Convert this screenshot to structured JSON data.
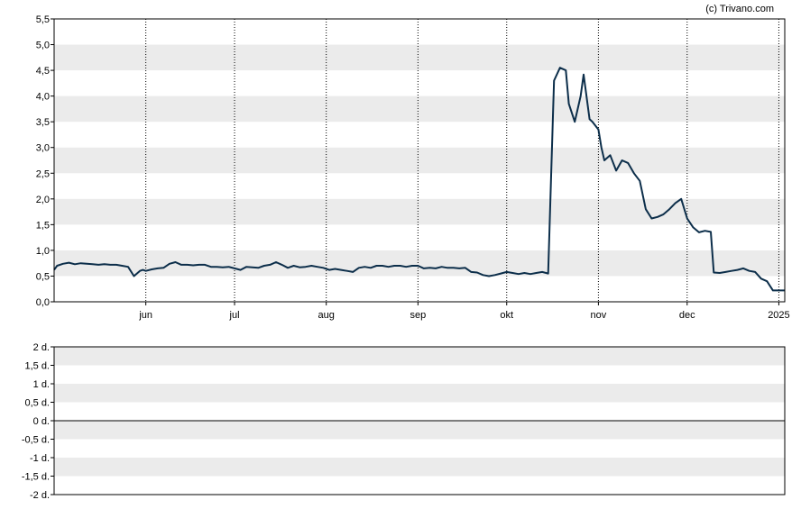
{
  "credit": "(c) Trivano.com",
  "colors": {
    "line": "#0c2e4a",
    "band": "#ebebeb",
    "axis": "#000000",
    "gridline": "#000000"
  },
  "chart_data": [
    {
      "type": "line",
      "title": "",
      "xlabel": "",
      "ylabel": "",
      "ylim": [
        0,
        5.5
      ],
      "yticks": [
        "0,0",
        "0,5",
        "1,0",
        "1,5",
        "2,0",
        "2,5",
        "3,0",
        "3,5",
        "4,0",
        "4,5",
        "5,0",
        "5,5"
      ],
      "ytick_values": [
        0,
        0.5,
        1,
        1.5,
        2,
        2.5,
        3,
        3.5,
        4,
        4.5,
        5,
        5.5
      ],
      "xlim": [
        "2024-05-01",
        "2025-01-03"
      ],
      "xticks": [
        {
          "label": "jun",
          "date": "2024-06-01"
        },
        {
          "label": "jul",
          "date": "2024-07-01"
        },
        {
          "label": "aug",
          "date": "2024-08-01"
        },
        {
          "label": "sep",
          "date": "2024-09-01"
        },
        {
          "label": "okt",
          "date": "2024-10-01"
        },
        {
          "label": "nov",
          "date": "2024-11-01"
        },
        {
          "label": "dec",
          "date": "2024-12-01"
        },
        {
          "label": "2025",
          "date": "2025-01-01"
        }
      ],
      "grid": "vertical dotted at month starts, horizontal alternating bands",
      "series": [
        {
          "x": [
            "2024-05-01",
            "2024-05-02",
            "2024-05-04",
            "2024-05-06",
            "2024-05-08",
            "2024-05-10",
            "2024-05-12",
            "2024-05-14",
            "2024-05-16",
            "2024-05-18",
            "2024-05-20",
            "2024-05-22",
            "2024-05-24",
            "2024-05-26",
            "2024-05-28",
            "2024-05-30",
            "2024-05-31",
            "2024-06-01",
            "2024-06-03",
            "2024-06-05",
            "2024-06-07",
            "2024-06-09",
            "2024-06-11",
            "2024-06-13",
            "2024-06-15",
            "2024-06-17",
            "2024-06-19",
            "2024-06-21",
            "2024-06-23",
            "2024-06-25",
            "2024-06-27",
            "2024-06-29",
            "2024-07-01",
            "2024-07-03",
            "2024-07-05",
            "2024-07-07",
            "2024-07-09",
            "2024-07-11",
            "2024-07-13",
            "2024-07-15",
            "2024-07-17",
            "2024-07-19",
            "2024-07-21",
            "2024-07-23",
            "2024-07-25",
            "2024-07-27",
            "2024-07-29",
            "2024-07-31",
            "2024-08-02",
            "2024-08-04",
            "2024-08-06",
            "2024-08-08",
            "2024-08-10",
            "2024-08-12",
            "2024-08-14",
            "2024-08-16",
            "2024-08-18",
            "2024-08-20",
            "2024-08-22",
            "2024-08-24",
            "2024-08-26",
            "2024-08-28",
            "2024-08-30",
            "2024-09-01",
            "2024-09-03",
            "2024-09-05",
            "2024-09-07",
            "2024-09-09",
            "2024-09-11",
            "2024-09-13",
            "2024-09-15",
            "2024-09-17",
            "2024-09-19",
            "2024-09-21",
            "2024-09-23",
            "2024-09-25",
            "2024-09-27",
            "2024-09-29",
            "2024-10-01",
            "2024-10-03",
            "2024-10-05",
            "2024-10-07",
            "2024-10-09",
            "2024-10-11",
            "2024-10-13",
            "2024-10-15",
            "2024-10-17",
            "2024-10-19",
            "2024-10-21",
            "2024-10-22",
            "2024-10-24",
            "2024-10-26",
            "2024-10-27",
            "2024-10-29",
            "2024-10-30",
            "2024-11-01",
            "2024-11-02",
            "2024-11-03",
            "2024-11-05",
            "2024-11-07",
            "2024-11-09",
            "2024-11-11",
            "2024-11-13",
            "2024-11-15",
            "2024-11-17",
            "2024-11-19",
            "2024-11-21",
            "2024-11-23",
            "2024-11-25",
            "2024-11-27",
            "2024-11-29",
            "2024-12-01",
            "2024-12-03",
            "2024-12-05",
            "2024-12-07",
            "2024-12-09",
            "2024-12-10",
            "2024-12-12",
            "2024-12-14",
            "2024-12-16",
            "2024-12-18",
            "2024-12-20",
            "2024-12-22",
            "2024-12-24",
            "2024-12-26",
            "2024-12-28",
            "2024-12-30",
            "2025-01-01",
            "2025-01-03"
          ],
          "y": [
            0.62,
            0.7,
            0.74,
            0.76,
            0.73,
            0.75,
            0.74,
            0.73,
            0.72,
            0.73,
            0.72,
            0.72,
            0.7,
            0.68,
            0.5,
            0.6,
            0.62,
            0.6,
            0.63,
            0.65,
            0.66,
            0.74,
            0.77,
            0.72,
            0.72,
            0.71,
            0.72,
            0.72,
            0.68,
            0.68,
            0.67,
            0.68,
            0.65,
            0.62,
            0.68,
            0.67,
            0.66,
            0.7,
            0.72,
            0.77,
            0.72,
            0.66,
            0.7,
            0.67,
            0.68,
            0.7,
            0.68,
            0.66,
            0.62,
            0.64,
            0.62,
            0.6,
            0.58,
            0.66,
            0.68,
            0.66,
            0.7,
            0.7,
            0.68,
            0.7,
            0.7,
            0.68,
            0.7,
            0.7,
            0.65,
            0.66,
            0.65,
            0.68,
            0.66,
            0.66,
            0.65,
            0.66,
            0.58,
            0.57,
            0.52,
            0.5,
            0.52,
            0.55,
            0.58,
            0.56,
            0.54,
            0.56,
            0.54,
            0.56,
            0.58,
            0.55,
            4.3,
            4.55,
            4.5,
            3.85,
            3.5,
            4.0,
            4.42,
            3.55,
            3.5,
            3.35,
            3.0,
            2.75,
            2.85,
            2.55,
            2.75,
            2.7,
            2.5,
            2.35,
            1.8,
            1.62,
            1.65,
            1.7,
            1.8,
            1.92,
            2.0,
            1.62,
            1.45,
            1.35,
            1.38,
            1.36,
            0.57,
            0.56,
            0.58,
            0.6,
            0.62,
            0.65,
            0.6,
            0.58,
            0.45,
            0.4,
            0.22,
            0.22,
            0.22
          ]
        }
      ]
    },
    {
      "type": "bar",
      "title": "",
      "xlabel": "",
      "ylabel": "",
      "ylim": [
        -2,
        2
      ],
      "yticks": [
        "2 d.",
        "1,5 d.",
        "1 d.",
        "0,5 d.",
        "0 d.",
        "-0,5 d.",
        "-1 d.",
        "-1,5 d.",
        "-2 d."
      ],
      "ytick_values": [
        2,
        1.5,
        1,
        0.5,
        0,
        -0.5,
        -1,
        -1.5,
        -2
      ],
      "series": []
    }
  ]
}
